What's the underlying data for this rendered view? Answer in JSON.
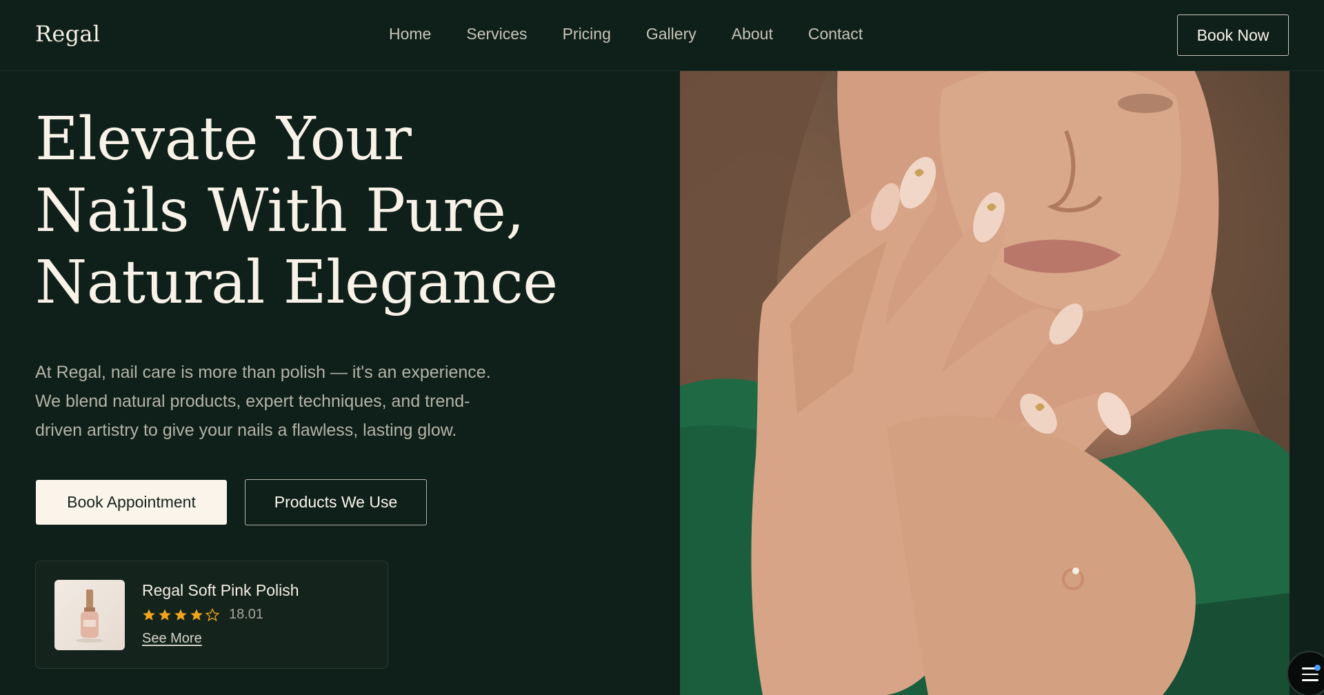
{
  "header": {
    "logo": "Regal",
    "nav": [
      "Home",
      "Services",
      "Pricing",
      "Gallery",
      "About",
      "Contact"
    ],
    "cta_label": "Book Now"
  },
  "hero": {
    "title_lines": [
      "Elevate Your",
      "Nails With Pure,",
      "Natural Elegance"
    ],
    "description_lines": [
      "At Regal, nail care is more than polish — it's an experience.",
      "We blend natural products, expert techniques, and trend-",
      "driven artistry to give your nails a flawless, lasting glow."
    ],
    "primary_button": "Book Appointment",
    "secondary_button": "Products We Use"
  },
  "product_card": {
    "name": "Regal Soft Pink Polish",
    "rating_value": "18.01",
    "stars_filled": 4,
    "stars_total": 5,
    "link_label": "See More"
  },
  "colors": {
    "background": "#0f201a",
    "cream": "#fbf4ea",
    "star": "#f0a51e",
    "sweater_green": "#1f6a45"
  },
  "icons": {
    "menu": "menu-icon",
    "star": "star-icon"
  }
}
